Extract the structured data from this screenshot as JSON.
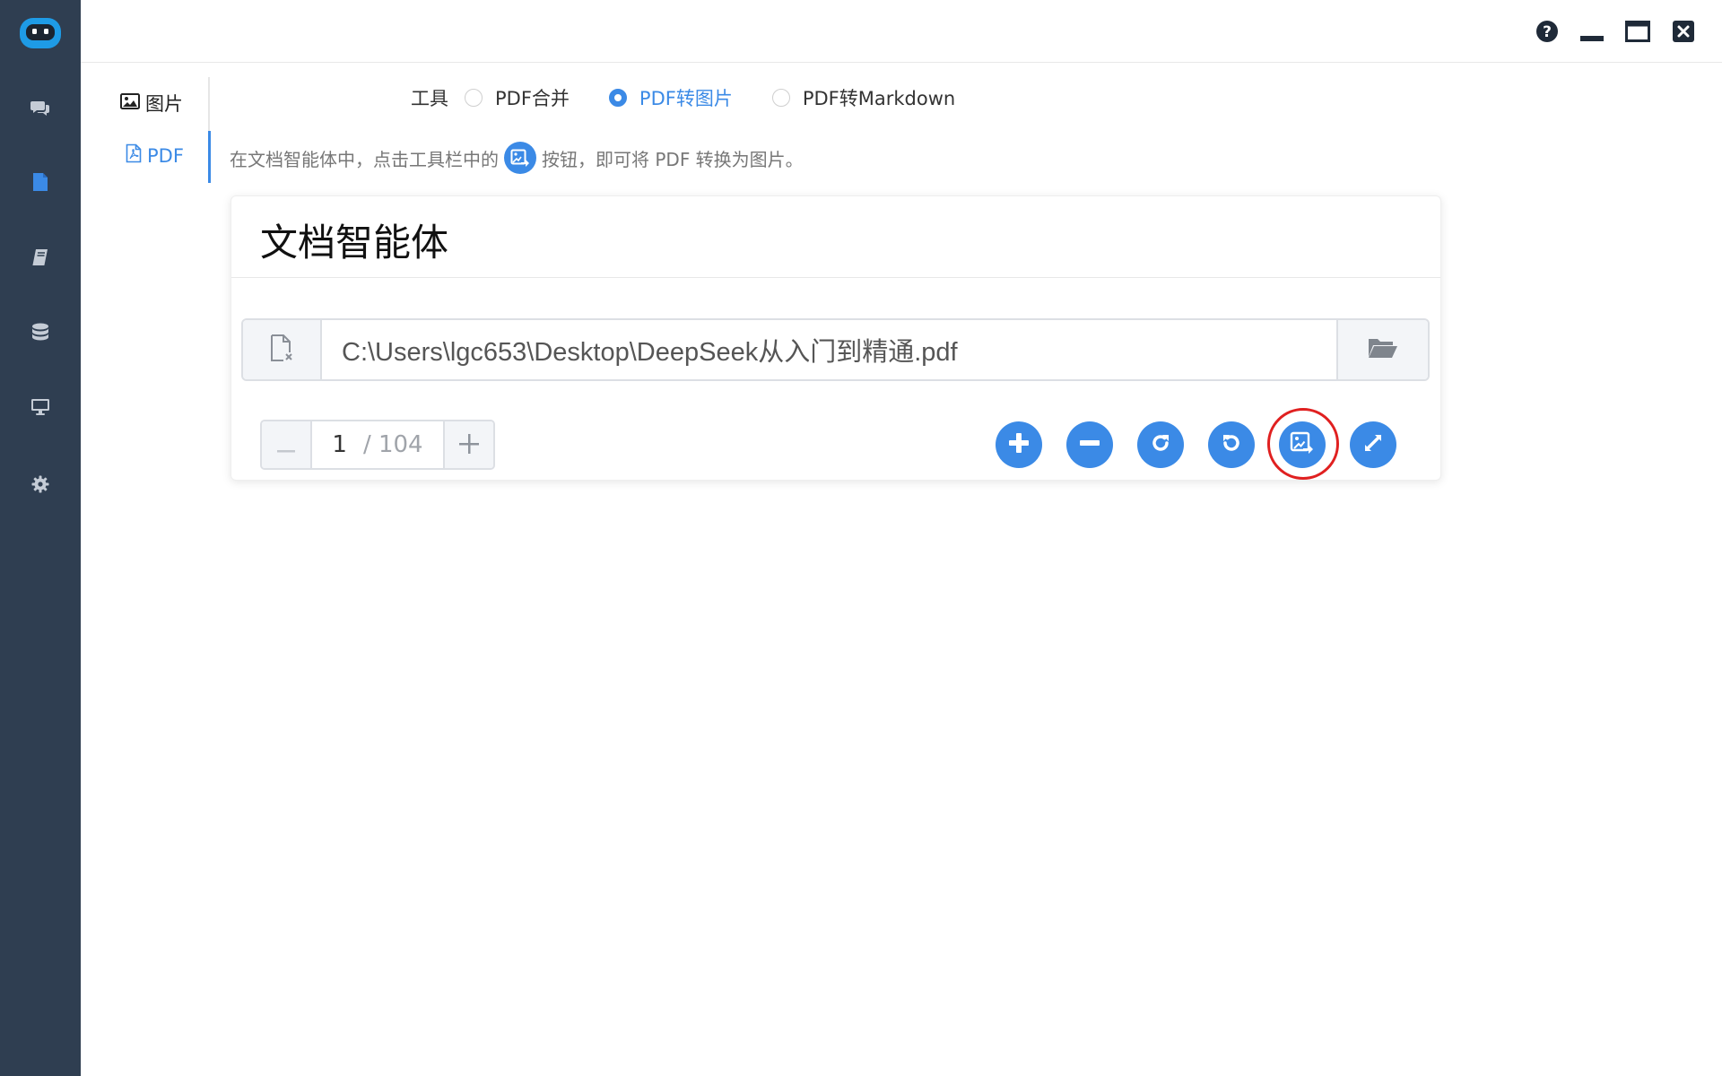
{
  "colors": {
    "rail_bg": "#2f3e51",
    "accent": "#3b8ae6",
    "highlight_ring": "#e02020"
  },
  "rail": {
    "items": [
      {
        "icon": "chat-bubbles-icon",
        "active": false
      },
      {
        "icon": "document-icon",
        "active": true
      },
      {
        "icon": "book-icon",
        "active": false
      },
      {
        "icon": "database-icon",
        "active": false
      },
      {
        "icon": "monitor-icon",
        "active": false
      },
      {
        "icon": "gear-icon",
        "active": false
      }
    ]
  },
  "window_controls": [
    "help-icon",
    "minimize-icon",
    "maximize-icon",
    "close-icon"
  ],
  "categories": {
    "image_label": "图片",
    "pdf_label": "PDF",
    "active": "pdf"
  },
  "tools": {
    "label": "工具",
    "options": [
      "PDF合并",
      "PDF转图片",
      "PDF转Markdown"
    ],
    "selected": "PDF转图片"
  },
  "hint": {
    "before": "在文档智能体中，点击工具栏中的",
    "after": "按钮，即可将 PDF 转换为图片。"
  },
  "card": {
    "title": "文档智能体",
    "path_value": "C:\\Users\\lgc653\\Desktop\\DeepSeek从入门到精通.pdf",
    "pager": {
      "current": "1",
      "total": "/ 104"
    },
    "toolbar": [
      "zoom-in-icon",
      "zoom-out-icon",
      "rotate-clockwise-icon",
      "rotate-counterclockwise-icon",
      "pdf-to-image-icon",
      "fullscreen-icon"
    ]
  }
}
